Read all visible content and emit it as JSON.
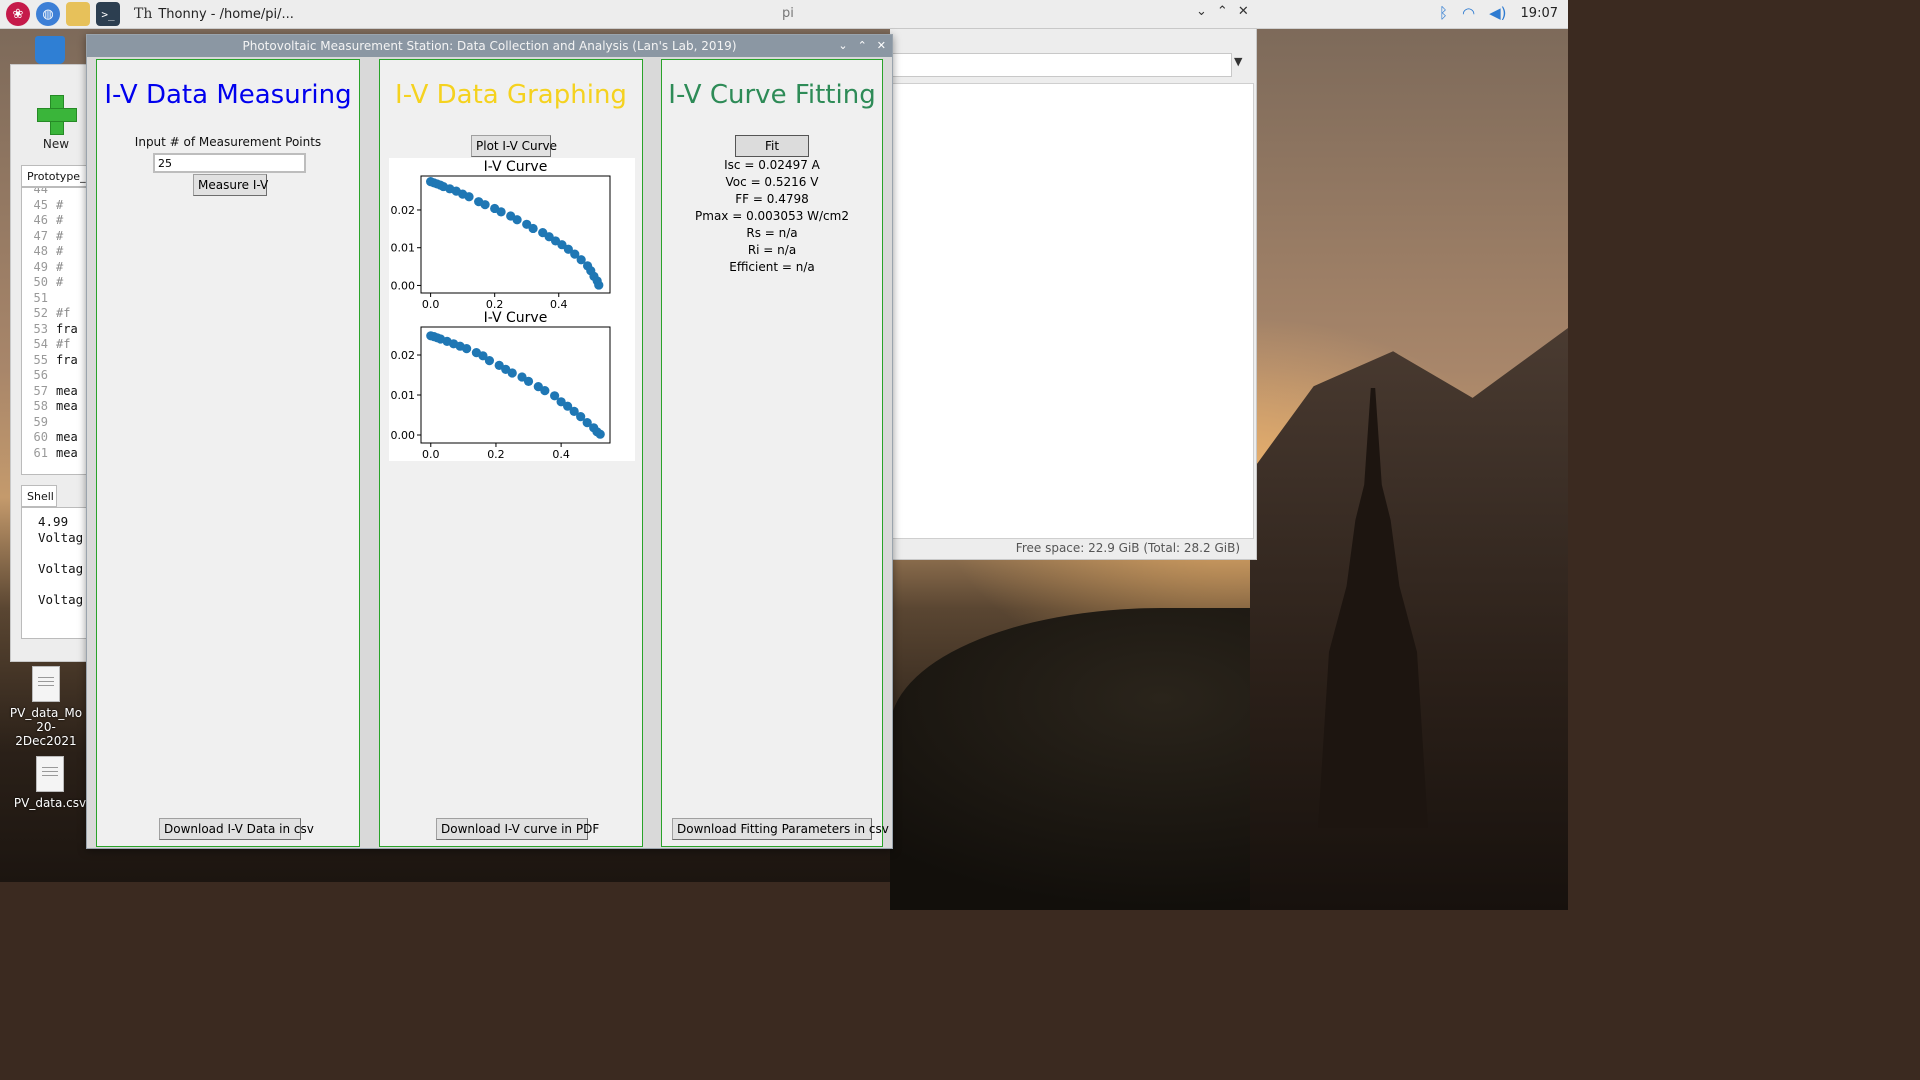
{
  "taskbar": {
    "thonny_label": "Thonny  -  /home/pi/...",
    "window_title": "pi",
    "clock": "19:07",
    "ctrl_min": "⌄",
    "ctrl_max": "⌃",
    "ctrl_close": "✕"
  },
  "desktop": {
    "icons": [
      {
        "label_line1": "PV_data_Mo",
        "label_line2": "20-2Dec2021"
      },
      {
        "label_line1": "PV_data.csv",
        "label_line2": ""
      }
    ]
  },
  "thonny": {
    "new_label": "New",
    "editor_tab": "Prototype_I",
    "lines": [
      {
        "num": "44",
        "text": ""
      },
      {
        "num": "45",
        "text": "# "
      },
      {
        "num": "46",
        "text": "# "
      },
      {
        "num": "47",
        "text": "# "
      },
      {
        "num": "48",
        "text": "# "
      },
      {
        "num": "49",
        "text": "# "
      },
      {
        "num": "50",
        "text": "# "
      },
      {
        "num": "51",
        "text": ""
      },
      {
        "num": "52",
        "text": "#f"
      },
      {
        "num": "53",
        "text": "fra"
      },
      {
        "num": "54",
        "text": "#f"
      },
      {
        "num": "55",
        "text": "fra"
      },
      {
        "num": "56",
        "text": ""
      },
      {
        "num": "57",
        "text": "mea"
      },
      {
        "num": "58",
        "text": "mea"
      },
      {
        "num": "59",
        "text": ""
      },
      {
        "num": "60",
        "text": "mea"
      },
      {
        "num": "61",
        "text": "mea"
      }
    ],
    "shell_tab": "Shell",
    "shell_lines": [
      "4.99",
      "Voltag",
      "",
      "Voltag",
      "",
      "Voltag"
    ]
  },
  "filemanager": {
    "status": "Free space: 22.9 GiB (Total: 28.2 GiB)"
  },
  "app": {
    "title": "Photovoltaic Measurement Station: Data Collection and Analysis (Lan's Lab, 2019)",
    "ctrl_min": "⌄",
    "ctrl_max": "⌃",
    "ctrl_close": "✕",
    "measure": {
      "title": "I-V Data Measuring",
      "title_color": "#0000ee",
      "input_label": "Input # of Measurement Points",
      "input_value": "25",
      "measure_button": "Measure I-V",
      "download_button": "Download I-V Data in csv"
    },
    "graph": {
      "title": "I-V Data Graphing",
      "title_color": "#f5d21f",
      "plot_button": "Plot I-V Curve",
      "download_button": "Download I-V curve in PDF"
    },
    "fit": {
      "title": "I-V Curve Fitting",
      "title_color": "#2e8b57",
      "fit_button": "Fit",
      "isc": "Isc = 0.02497 A",
      "voc": "Voc = 0.5216 V",
      "ff": "FF = 0.4798",
      "pmax": "Pmax = 0.003053 W/cm2",
      "rs": "Rs = n/a",
      "ri": "Ri = n/a",
      "efficient": "Efficient = n/a",
      "download_button": "Download Fitting Parameters in csv"
    }
  },
  "chart_data": [
    {
      "type": "scatter",
      "title": "I-V Curve",
      "color": "#1f77b4",
      "xlim": [
        -0.03,
        0.56
      ],
      "ylim": [
        -0.002,
        0.029
      ],
      "xticks": [
        0.0,
        0.2,
        0.4
      ],
      "xtick_labels": [
        "0.0",
        "0.2",
        "0.4"
      ],
      "yticks": [
        0.0,
        0.01,
        0.02
      ],
      "ytick_labels": [
        "0.00",
        "0.01",
        "0.02"
      ],
      "x": [
        0.0,
        0.01,
        0.02,
        0.03,
        0.04,
        0.06,
        0.08,
        0.1,
        0.12,
        0.15,
        0.17,
        0.2,
        0.22,
        0.25,
        0.27,
        0.3,
        0.32,
        0.35,
        0.37,
        0.39,
        0.41,
        0.43,
        0.45,
        0.47,
        0.49,
        0.5,
        0.51,
        0.52,
        0.525
      ],
      "y": [
        0.0275,
        0.0272,
        0.0269,
        0.0266,
        0.0262,
        0.0256,
        0.025,
        0.0242,
        0.0235,
        0.0222,
        0.0214,
        0.0204,
        0.0195,
        0.0184,
        0.0174,
        0.0162,
        0.0151,
        0.014,
        0.0129,
        0.0118,
        0.0108,
        0.0096,
        0.0083,
        0.0068,
        0.0052,
        0.0039,
        0.0024,
        0.0012,
        0.0001
      ]
    },
    {
      "type": "scatter",
      "title": "I-V Curve",
      "color": "#1f77b4",
      "xlim": [
        -0.03,
        0.55
      ],
      "ylim": [
        -0.002,
        0.027
      ],
      "xticks": [
        0.0,
        0.2,
        0.4
      ],
      "xtick_labels": [
        "0.0",
        "0.2",
        "0.4"
      ],
      "yticks": [
        0.0,
        0.01,
        0.02
      ],
      "ytick_labels": [
        "0.00",
        "0.01",
        "0.02"
      ],
      "x": [
        0.0,
        0.01,
        0.02,
        0.03,
        0.05,
        0.07,
        0.09,
        0.11,
        0.14,
        0.16,
        0.18,
        0.21,
        0.23,
        0.25,
        0.28,
        0.3,
        0.33,
        0.35,
        0.38,
        0.4,
        0.42,
        0.44,
        0.46,
        0.48,
        0.5,
        0.51,
        0.52
      ],
      "y": [
        0.0248,
        0.0246,
        0.0243,
        0.024,
        0.0234,
        0.0228,
        0.0222,
        0.0216,
        0.0206,
        0.0198,
        0.0186,
        0.0174,
        0.0164,
        0.0155,
        0.0145,
        0.0134,
        0.0121,
        0.0111,
        0.0098,
        0.0083,
        0.0072,
        0.0059,
        0.0046,
        0.0031,
        0.0018,
        0.0008,
        0.0002
      ]
    }
  ]
}
